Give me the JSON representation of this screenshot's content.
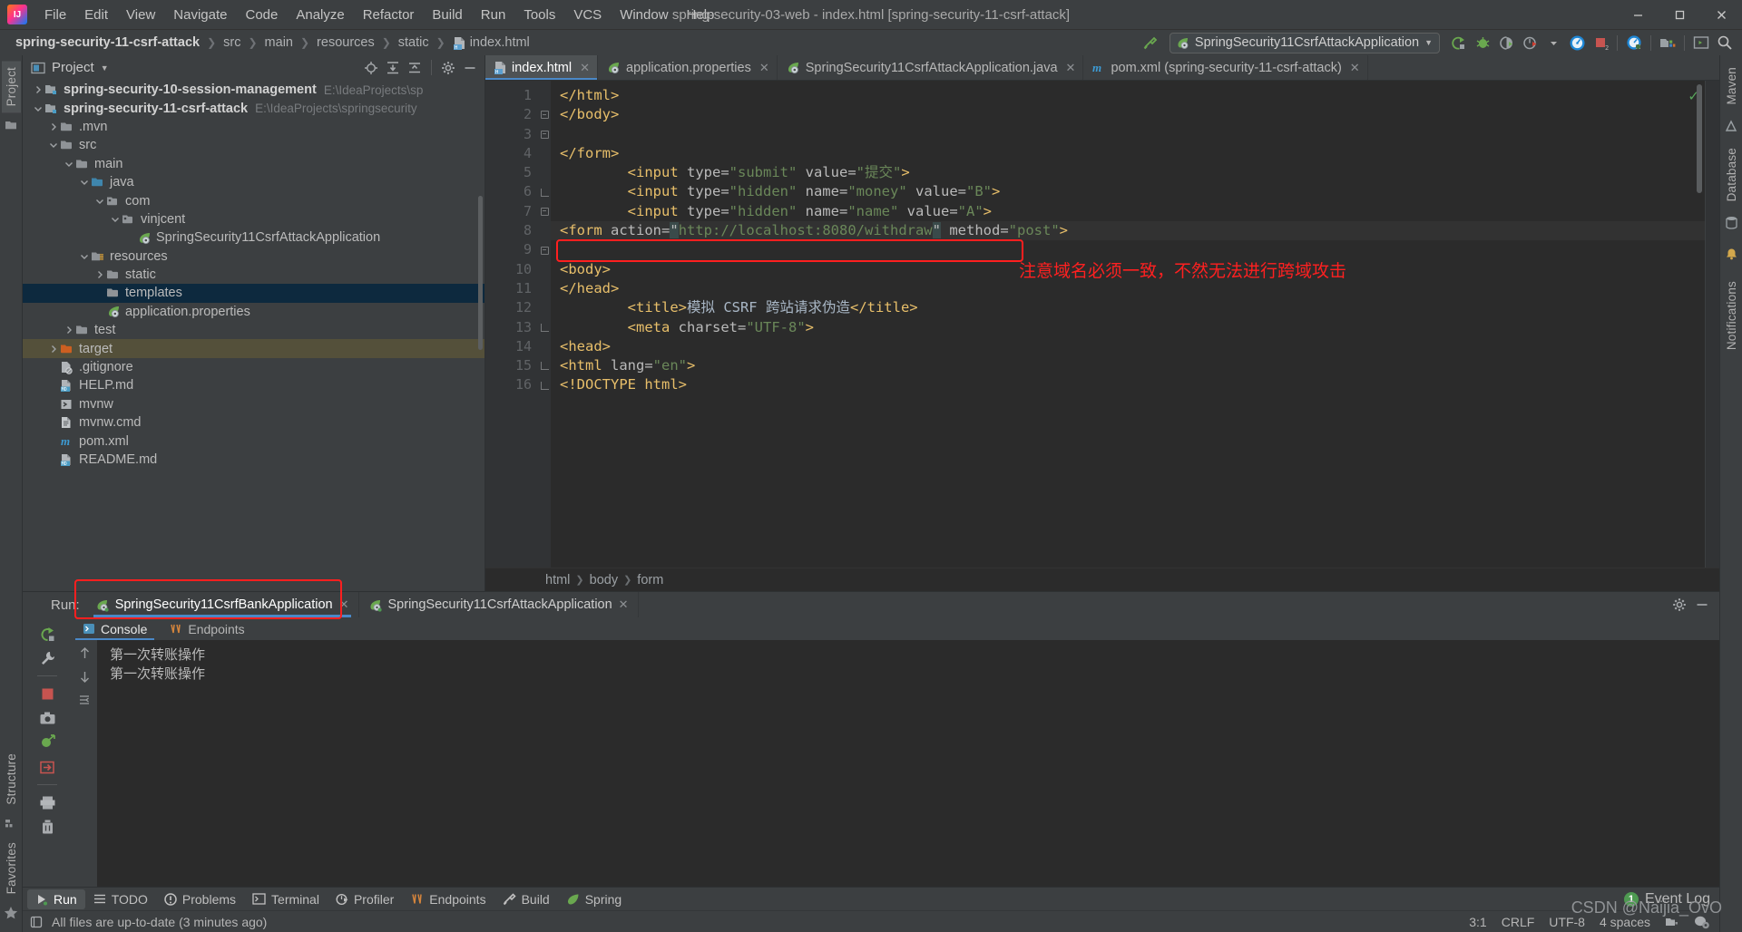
{
  "window": {
    "title": "spring-security-03-web - index.html [spring-security-11-csrf-attack]",
    "minimize": "—",
    "maximize": "❐",
    "close": "✕"
  },
  "menu": [
    {
      "label": "File"
    },
    {
      "label": "Edit"
    },
    {
      "label": "View"
    },
    {
      "label": "Navigate"
    },
    {
      "label": "Code"
    },
    {
      "label": "Analyze"
    },
    {
      "label": "Refactor"
    },
    {
      "label": "Build"
    },
    {
      "label": "Run"
    },
    {
      "label": "Tools"
    },
    {
      "label": "VCS"
    },
    {
      "label": "Window"
    },
    {
      "label": "Help"
    }
  ],
  "breadcrumbs": [
    {
      "label": "spring-security-11-csrf-attack",
      "bold": true
    },
    {
      "label": "src"
    },
    {
      "label": "main"
    },
    {
      "label": "resources"
    },
    {
      "label": "static"
    },
    {
      "label": "index.html",
      "icon": "html-file-icon"
    }
  ],
  "toolbar": {
    "run_config": "SpringSecurity11CsrfAttackApplication",
    "run_config_icon": "spring-leaf-icon",
    "dropdown_caret": "▼",
    "icons": [
      "build-icon",
      "debug-icon",
      "coverage-icon",
      "profiler-icon",
      "profiler-dropdown-icon",
      "run-dashboard-icon",
      "stop-icon",
      "attach-profiler-icon",
      "project-structure-icon",
      "terminal-icon",
      "search-icon"
    ],
    "hammer_icon": "build-hammer-icon"
  },
  "left_rail": {
    "tabs": [
      {
        "label": "Project",
        "active": true
      }
    ],
    "bottom_tabs": [
      {
        "label": "Structure"
      },
      {
        "label": "Favorites"
      }
    ],
    "icons": [
      "folder-icon",
      "structure-icon",
      "star-icon"
    ]
  },
  "right_rail": {
    "tabs": [
      {
        "label": "Maven"
      },
      {
        "label": "Database"
      },
      {
        "label": "Notifications"
      }
    ],
    "icons": [
      "maven-icon",
      "database-icon",
      "bell-icon"
    ]
  },
  "project_panel": {
    "title": "Project",
    "title_icon": "project-view-icon",
    "dropdown_caret": "▼",
    "actions": [
      "locate-icon",
      "expand-all-icon",
      "collapse-all-icon",
      "gear-icon",
      "hide-icon"
    ],
    "tree": [
      {
        "indent": 0,
        "arrow": "›",
        "icon": "module-icon",
        "name": "spring-security-10-session-management",
        "bold": true,
        "path": "E:\\IdeaProjects\\sp"
      },
      {
        "indent": 0,
        "arrow": "⌄",
        "icon": "module-icon",
        "name": "spring-security-11-csrf-attack",
        "bold": true,
        "path": "E:\\IdeaProjects\\springsecurity"
      },
      {
        "indent": 1,
        "arrow": "›",
        "icon": "folder-icon",
        "name": ".mvn"
      },
      {
        "indent": 1,
        "arrow": "⌄",
        "icon": "folder-icon",
        "name": "src"
      },
      {
        "indent": 2,
        "arrow": "⌄",
        "icon": "folder-icon",
        "name": "main"
      },
      {
        "indent": 3,
        "arrow": "⌄",
        "icon": "source-folder-icon",
        "name": "java"
      },
      {
        "indent": 4,
        "arrow": "⌄",
        "icon": "package-icon",
        "name": "com"
      },
      {
        "indent": 5,
        "arrow": "⌄",
        "icon": "package-icon",
        "name": "vinjcent"
      },
      {
        "indent": 6,
        "arrow": "",
        "icon": "spring-class-icon",
        "name": "SpringSecurity11CsrfAttackApplication"
      },
      {
        "indent": 3,
        "arrow": "⌄",
        "icon": "resource-folder-icon",
        "name": "resources"
      },
      {
        "indent": 4,
        "arrow": "›",
        "icon": "folder-icon",
        "name": "static"
      },
      {
        "indent": 4,
        "arrow": "",
        "icon": "folder-icon",
        "name": "templates",
        "selected": true
      },
      {
        "indent": 4,
        "arrow": "",
        "icon": "spring-properties-icon",
        "name": "application.properties"
      },
      {
        "indent": 2,
        "arrow": "›",
        "icon": "folder-icon",
        "name": "test"
      },
      {
        "indent": 1,
        "arrow": "›",
        "icon": "target-folder-icon",
        "name": "target",
        "highlight": true
      },
      {
        "indent": 1,
        "arrow": "",
        "icon": "gitignore-icon",
        "name": ".gitignore"
      },
      {
        "indent": 1,
        "arrow": "",
        "icon": "markdown-icon",
        "name": "HELP.md"
      },
      {
        "indent": 1,
        "arrow": "",
        "icon": "shell-script-icon",
        "name": "mvnw"
      },
      {
        "indent": 1,
        "arrow": "",
        "icon": "cmd-file-icon",
        "name": "mvnw.cmd"
      },
      {
        "indent": 1,
        "arrow": "",
        "icon": "maven-pom-icon",
        "name": "pom.xml"
      },
      {
        "indent": 1,
        "arrow": "",
        "icon": "markdown-icon",
        "name": "README.md"
      }
    ]
  },
  "editor": {
    "tabs": [
      {
        "label": "index.html",
        "icon": "html-file-icon",
        "active": true,
        "close": "✕"
      },
      {
        "label": "application.properties",
        "icon": "spring-properties-icon",
        "active": false,
        "close": "✕"
      },
      {
        "label": "SpringSecurity11CsrfAttackApplication.java",
        "icon": "spring-class-icon",
        "active": false,
        "close": "✕"
      },
      {
        "label": "pom.xml (spring-security-11-csrf-attack)",
        "icon": "maven-pom-icon",
        "active": false,
        "close": "✕"
      }
    ],
    "line_numbers": [
      1,
      2,
      3,
      4,
      5,
      6,
      7,
      8,
      9,
      10,
      11,
      12,
      13,
      14,
      15,
      16
    ],
    "current_line": 9,
    "code_lines": [
      {
        "n": 1,
        "indent": 0,
        "parts": [
          {
            "t": "tag",
            "v": "<!DOCTYPE html>"
          }
        ]
      },
      {
        "n": 2,
        "indent": 0,
        "fold": "open",
        "parts": [
          {
            "t": "tag",
            "v": "<html "
          },
          {
            "t": "attr",
            "v": "lang"
          },
          {
            "t": "eq",
            "v": "="
          },
          {
            "t": "val",
            "v": "\"en\""
          },
          {
            "t": "tag",
            "v": ">"
          }
        ]
      },
      {
        "n": 3,
        "indent": 0,
        "fold": "open",
        "parts": [
          {
            "t": "tag",
            "v": "<head>"
          }
        ]
      },
      {
        "n": 4,
        "indent": 2,
        "parts": [
          {
            "t": "tag",
            "v": "<meta "
          },
          {
            "t": "attr",
            "v": "charset"
          },
          {
            "t": "eq",
            "v": "="
          },
          {
            "t": "val",
            "v": "\"UTF-8\""
          },
          {
            "t": "tag",
            "v": ">"
          }
        ]
      },
      {
        "n": 5,
        "indent": 2,
        "parts": [
          {
            "t": "tag",
            "v": "<title>"
          },
          {
            "t": "txt",
            "v": "模拟 CSRF 跨站请求伪造"
          },
          {
            "t": "tag",
            "v": "</title>"
          }
        ]
      },
      {
        "n": 6,
        "indent": 0,
        "fold": "close",
        "parts": [
          {
            "t": "tag",
            "v": "</head>"
          }
        ]
      },
      {
        "n": 7,
        "indent": 0,
        "fold": "open",
        "parts": [
          {
            "t": "tag",
            "v": "<body>"
          }
        ]
      },
      {
        "n": 8,
        "indent": 0,
        "parts": []
      },
      {
        "n": 9,
        "indent": 0,
        "fold": "open",
        "current": true,
        "parts": [
          {
            "t": "tag",
            "v": "<form "
          },
          {
            "t": "attr",
            "v": "action"
          },
          {
            "t": "eq",
            "v": "="
          },
          {
            "t": "cursel",
            "v": "\""
          },
          {
            "t": "val",
            "v": "http://localhost:8080/withdraw"
          },
          {
            "t": "cursel",
            "v": "\""
          },
          {
            "t": "attr",
            "v": " method"
          },
          {
            "t": "eq",
            "v": "="
          },
          {
            "t": "val",
            "v": "\"post\""
          },
          {
            "t": "tag",
            "v": ">"
          }
        ]
      },
      {
        "n": 10,
        "indent": 2,
        "parts": [
          {
            "t": "tag",
            "v": "<input "
          },
          {
            "t": "attr",
            "v": "type"
          },
          {
            "t": "eq",
            "v": "="
          },
          {
            "t": "val",
            "v": "\"hidden\""
          },
          {
            "t": "attr",
            "v": " name"
          },
          {
            "t": "eq",
            "v": "="
          },
          {
            "t": "val",
            "v": "\"name\""
          },
          {
            "t": "attr",
            "v": " value"
          },
          {
            "t": "eq",
            "v": "="
          },
          {
            "t": "val",
            "v": "\"A\""
          },
          {
            "t": "tag",
            "v": ">"
          }
        ]
      },
      {
        "n": 11,
        "indent": 2,
        "parts": [
          {
            "t": "tag",
            "v": "<input "
          },
          {
            "t": "attr",
            "v": "type"
          },
          {
            "t": "eq",
            "v": "="
          },
          {
            "t": "val",
            "v": "\"hidden\""
          },
          {
            "t": "attr",
            "v": " name"
          },
          {
            "t": "eq",
            "v": "="
          },
          {
            "t": "val",
            "v": "\"money\""
          },
          {
            "t": "attr",
            "v": " value"
          },
          {
            "t": "eq",
            "v": "="
          },
          {
            "t": "val",
            "v": "\"B\""
          },
          {
            "t": "tag",
            "v": ">"
          }
        ]
      },
      {
        "n": 12,
        "indent": 2,
        "parts": [
          {
            "t": "tag",
            "v": "<input "
          },
          {
            "t": "attr",
            "v": "type"
          },
          {
            "t": "eq",
            "v": "="
          },
          {
            "t": "val",
            "v": "\"submit\""
          },
          {
            "t": "attr",
            "v": " value"
          },
          {
            "t": "eq",
            "v": "="
          },
          {
            "t": "val",
            "v": "\"提交\""
          },
          {
            "t": "tag",
            "v": ">"
          }
        ]
      },
      {
        "n": 13,
        "indent": 0,
        "fold": "close",
        "parts": [
          {
            "t": "tag",
            "v": "</form>"
          }
        ]
      },
      {
        "n": 14,
        "indent": 0,
        "parts": []
      },
      {
        "n": 15,
        "indent": 0,
        "fold": "close",
        "parts": [
          {
            "t": "tag",
            "v": "</body>"
          }
        ]
      },
      {
        "n": 16,
        "indent": 0,
        "fold": "close",
        "parts": [
          {
            "t": "tag",
            "v": "</html>"
          }
        ]
      }
    ],
    "annotation_text": "注意域名必须一致，不然无法进行跨域攻击",
    "annotation_color": "#ff2020",
    "inspection_status": "✓",
    "breadcrumb_path": [
      "html",
      "body",
      "form"
    ]
  },
  "run_panel": {
    "label": "Run:",
    "tabs": [
      {
        "label": "SpringSecurity11CsrfBankApplication",
        "icon": "spring-running-icon",
        "active": true,
        "close": "✕"
      },
      {
        "label": "SpringSecurity11CsrfAttackApplication",
        "icon": "spring-running-icon",
        "active": false,
        "close": "✕"
      }
    ],
    "header_actions": [
      "gear-icon",
      "hide-icon"
    ],
    "rail_icons": [
      "rerun-icon",
      "wrench-icon",
      "stop-icon",
      "camera-icon",
      "thread-dump-icon",
      "scroll-to-end-icon",
      "print-icon",
      "trash-icon"
    ],
    "console_tabs": [
      {
        "label": "Console",
        "icon": "console-icon",
        "active": true
      },
      {
        "label": "Endpoints",
        "icon": "endpoints-icon",
        "active": false
      }
    ],
    "console_side_icons": [
      "up-arrow-icon",
      "down-arrow-icon",
      "soft-wrap-icon"
    ],
    "output": [
      "第一次转账操作",
      "第一次转账操作"
    ]
  },
  "tool_windows": [
    {
      "label": "Run",
      "icon": "run-icon",
      "active": true
    },
    {
      "label": "TODO",
      "icon": "todo-icon"
    },
    {
      "label": "Problems",
      "icon": "problems-icon"
    },
    {
      "label": "Terminal",
      "icon": "terminal-icon"
    },
    {
      "label": "Profiler",
      "icon": "profiler-icon"
    },
    {
      "label": "Endpoints",
      "icon": "endpoints-icon"
    },
    {
      "label": "Build",
      "icon": "build-hammer-icon"
    },
    {
      "label": "Spring",
      "icon": "spring-leaf-icon"
    }
  ],
  "event_log": {
    "label": "Event Log",
    "count": "1"
  },
  "statusbar": {
    "message": "All files are up-to-date (3 minutes ago)",
    "message_icon": "sync-status-icon",
    "caret_position": "3:1",
    "line_separator": "CRLF",
    "encoding": "UTF-8",
    "indent": "4 spaces",
    "git_branch_icon": "vcs-icon",
    "inspections_icon": "inspection-gear-icon"
  },
  "watermark": "CSDN @Naijia_OvO",
  "colors": {
    "accent": "#4a88c7",
    "annotation_red": "#ff1f1f",
    "panel_bg": "#3c3f41",
    "editor_bg": "#2b2b2b",
    "selection_blue": "#0d293e",
    "tag_color": "#e8bf6a",
    "value_color": "#6a8759"
  }
}
